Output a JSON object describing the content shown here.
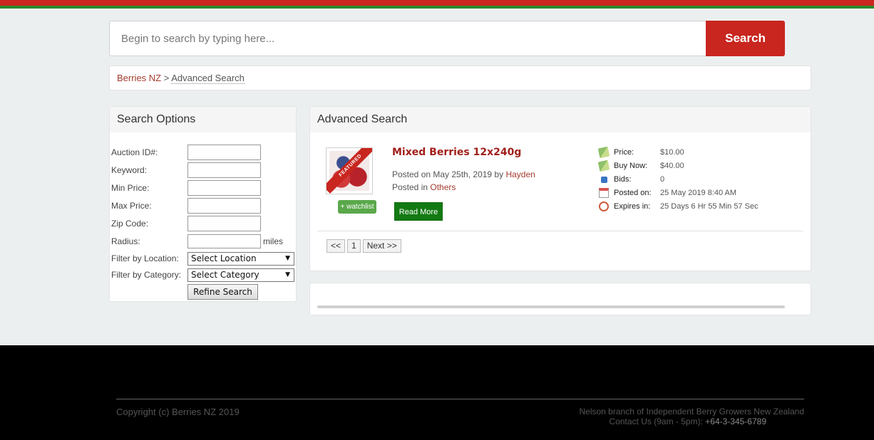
{
  "header": {
    "accent_red": "#c8261f",
    "accent_green": "#2a8a2a"
  },
  "search": {
    "placeholder": "Begin to search by typing here...",
    "button_label": "Search"
  },
  "breadcrumb": {
    "home": "Berries NZ",
    "separator": ">",
    "current": "Advanced Search"
  },
  "options": {
    "title": "Search Options",
    "fields": [
      {
        "label": "Auction ID#:"
      },
      {
        "label": "Keyword:"
      },
      {
        "label": "Min Price:"
      },
      {
        "label": "Max Price:"
      },
      {
        "label": "Zip Code:"
      },
      {
        "label": "Radius:",
        "unit": "miles"
      }
    ],
    "location": {
      "label": "Filter by Location:",
      "selected": "Select Location"
    },
    "category": {
      "label": "Filter by Category:",
      "selected": "Select Category"
    },
    "refine_label": "Refine Search"
  },
  "results": {
    "title": "Advanced Search",
    "item": {
      "badge": "FEATURED",
      "watchlist_label": "+ watchlist",
      "title": "Mixed Berries 12x240g",
      "posted_prefix": "Posted on May 25th, 2019 by",
      "author": "Hayden",
      "category_prefix": "Posted in",
      "category": "Others",
      "read_more_label": "Read More",
      "stats": [
        {
          "icon": "price-icon",
          "label": "Price:",
          "value": "$10.00"
        },
        {
          "icon": "buy-now-icon",
          "label": "Buy Now:",
          "value": "$40.00"
        },
        {
          "icon": "bids-icon",
          "label": "Bids:",
          "value": "0"
        },
        {
          "icon": "calendar-icon",
          "label": "Posted on:",
          "value": "25 May 2019 8:40 AM"
        },
        {
          "icon": "clock-icon",
          "label": "Expires in:",
          "value": "25 Days 6 Hr 55 Min 57 Sec"
        }
      ]
    },
    "pager": {
      "prev": "<<",
      "page": "1",
      "next": "Next >>"
    }
  },
  "footer": {
    "copyright": "Copyright (c) Berries NZ 2019",
    "org": "Nelson branch of Independent Berry Growers New Zealand",
    "contact": "Contact Us (9am - 5pm):",
    "phone": "+64-3-345-6789"
  }
}
